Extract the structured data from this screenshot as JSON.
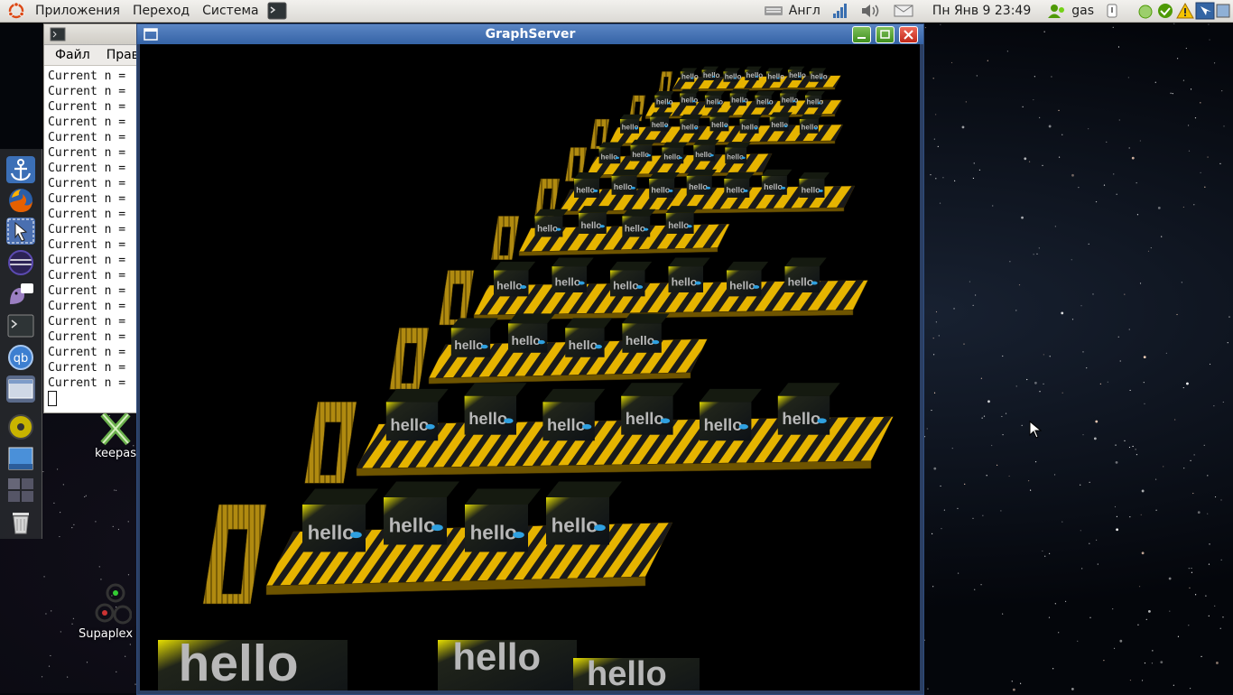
{
  "top_panel": {
    "menu_applications": "Приложения",
    "menu_places": "Переход",
    "menu_system": "Система",
    "keyboard_layout": "Англ",
    "datetime": "Пн Янв  9 23:49",
    "username": "gas"
  },
  "terminal": {
    "menu_file": "Файл",
    "menu_edit": "Прав",
    "lines": [
      "Current n =",
      "Current n =",
      "Current n =",
      "Current n =",
      "Current n =",
      "Current n =",
      "Current n =",
      "Current n =",
      "Current n =",
      "Current n =",
      "Current n =",
      "Current n =",
      "Current n =",
      "Current n =",
      "Current n =",
      "Current n =",
      "Current n =",
      "Current n =",
      "Current n =",
      "Current n =",
      "Current n ="
    ]
  },
  "graph_window": {
    "title": "GraphServer",
    "cube_label": "hello"
  },
  "desktop_icons": {
    "keepass_label": "keepas",
    "supaplex_label": "Supaplex I"
  },
  "colors": {
    "panel_bg": "#dcdad5",
    "titlebar_active": "#3563a6",
    "stripe_yellow": "#e6b400",
    "stripe_dark": "#1a1a1a",
    "cube_dark": "#0d1116",
    "cube_highlight": "#e8e000",
    "cube_dot": "#2fa0e0"
  }
}
